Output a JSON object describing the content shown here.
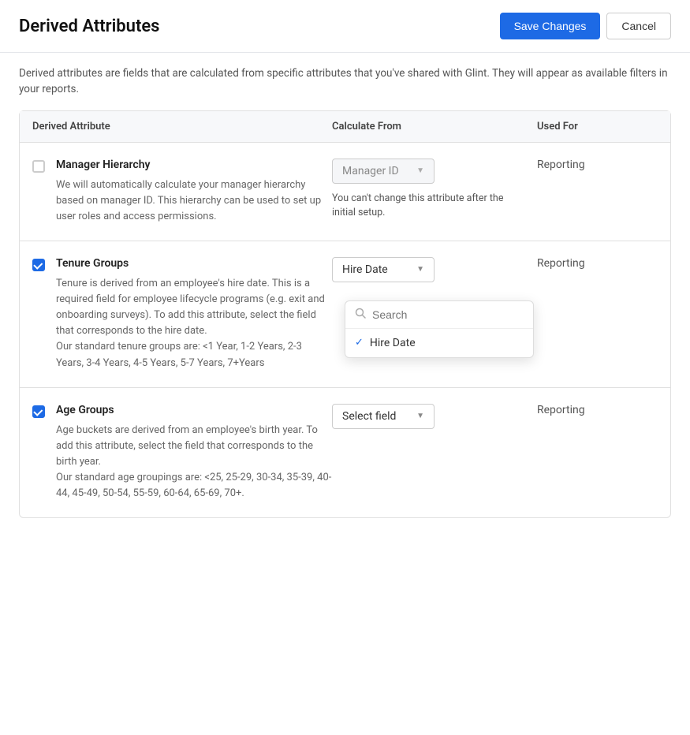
{
  "page": {
    "title": "Derived Attributes",
    "description": "Derived attributes are fields that are calculated from specific attributes that you've shared with Glint. They will appear as available filters in your reports.",
    "save_label": "Save Changes",
    "cancel_label": "Cancel"
  },
  "table": {
    "headers": [
      "Derived Attribute",
      "Calculate From",
      "Used For"
    ],
    "rows": [
      {
        "id": "manager-hierarchy",
        "checked": false,
        "name": "Manager Hierarchy",
        "description": "We will automatically calculate your manager hierarchy based on manager ID. This hierarchy can be used to set up user roles and access permissions.",
        "calculate_from": "Manager ID",
        "calculate_note": "You can't change this attribute after the initial setup.",
        "used_for": "Reporting",
        "dropdown_open": false,
        "dropdown_disabled": true
      },
      {
        "id": "tenure-groups",
        "checked": true,
        "name": "Tenure Groups",
        "description": "Tenure is derived from an employee's hire date. This is a required field for employee lifecycle programs (e.g. exit and onboarding surveys). To add this attribute, select the field that corresponds to the hire date.\nOur standard tenure groups are: <1 Year, 1-2 Years, 2-3 Years, 3-4 Years, 4-5 Years, 5-7 Years, 7+Years",
        "calculate_from": "Hire Date",
        "used_for": "Reporting",
        "dropdown_open": true,
        "dropdown_items": [
          "Hire Date"
        ],
        "selected_item": "Hire Date",
        "search_placeholder": "Search"
      },
      {
        "id": "age-groups",
        "checked": true,
        "name": "Age Groups",
        "description": "Age buckets are derived from an employee's birth year. To add this attribute, select the field that corresponds to the birth year.\nOur standard age groupings are: <25, 25-29, 30-34, 35-39, 40-44, 45-49, 50-54, 55-59, 60-64, 65-69, 70+.",
        "calculate_from": "Select field",
        "used_for": "Reporting",
        "dropdown_open": false
      }
    ]
  }
}
